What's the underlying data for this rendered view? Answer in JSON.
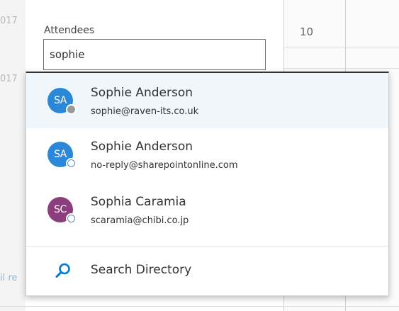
{
  "background": {
    "left_fragments": [
      "017",
      "017",
      "il re"
    ],
    "day_number": "10"
  },
  "attendees": {
    "label": "Attendees",
    "value": "sophie"
  },
  "suggestions": [
    {
      "initials": "SA",
      "name": "Sophie Anderson",
      "email": "sophie@raven-its.co.uk",
      "avatar_color": "#2b88d8",
      "presence": "grey",
      "selected": true
    },
    {
      "initials": "SA",
      "name": "Sophie Anderson",
      "email": "no-reply@sharepointonline.com",
      "avatar_color": "#2b88d8",
      "presence": "outline",
      "selected": false
    },
    {
      "initials": "SC",
      "name": "Sophia Caramia",
      "email": "scaramia@chibi.co.jp",
      "avatar_color": "#8c3d7b",
      "presence": "outline",
      "selected": false
    }
  ],
  "search_directory": {
    "label": "Search Directory",
    "icon": "search-icon",
    "icon_color": "#0078d4"
  }
}
